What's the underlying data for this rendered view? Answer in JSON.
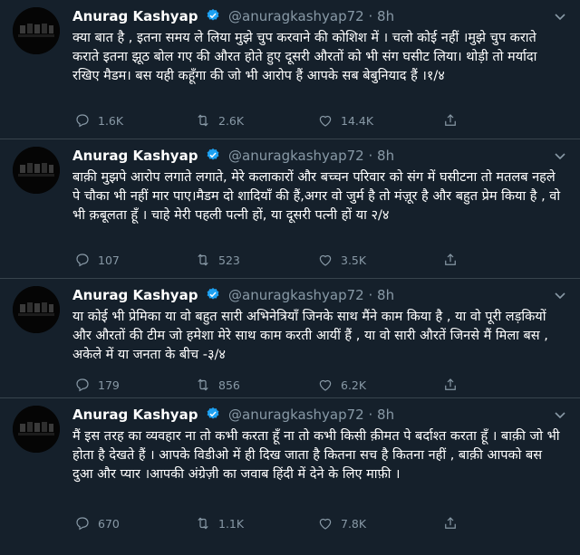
{
  "tweets": [
    {
      "name": "Anurag Kashyap",
      "handle": "@anuragkashyap72",
      "sep": "·",
      "time": "8h",
      "text": "क्या बात है , इतना समय ले लिया मुझे चुप करवाने की कोशिश में । चलो कोई नहीं ।मुझे चुप कराते कराते इतना झूठ बोल गए की औरत होते हुए दूसरी औरतों को भी संग घसीट लिया। थोड़ी तो मर्यादा रखिए मैडम। बस यही कहूँगा की जो भी आरोप हैं आपके सब बेबुनियाद हैं ।१/४",
      "replies": "1.6K",
      "retweets": "2.6K",
      "likes": "14.4K"
    },
    {
      "name": "Anurag Kashyap",
      "handle": "@anuragkashyap72",
      "sep": "·",
      "time": "8h",
      "text": "बाक़ी मुझपे आरोप लगाते लगाते, मेरे कलाकारों और बच्चन परिवार को संग में घसीटना तो मतलब नहले पे चौका भी नहीं मार पाए।मैडम दो शादियाँ की हैं,अगर वो जुर्म है तो मंज़ूर है और बहुत प्रेम किया है , वो भी क़बूलता हूँ । चाहे मेरी पहली पत्नी हों, या दूसरी पत्नी हों या २/४",
      "replies": "107",
      "retweets": "523",
      "likes": "3.5K"
    },
    {
      "name": "Anurag Kashyap",
      "handle": "@anuragkashyap72",
      "sep": "·",
      "time": "8h",
      "text": "या कोई भी प्रेमिका या वो बहुत सारी अभिनेत्रियाँ जिनके साथ मैंने काम किया है , या वो पूरी लड़कियों और औरतों की टीम जो हमेशा मेरे साथ काम करती आयीं हैं , या वो सारी औरतें जिनसे मैं मिला बस , अकेले में या जनता के बीच -३/४",
      "replies": "179",
      "retweets": "856",
      "likes": "6.2K"
    },
    {
      "name": "Anurag Kashyap",
      "handle": "@anuragkashyap72",
      "sep": "·",
      "time": "8h",
      "text": "मैं इस तरह का व्यवहार ना तो कभी करता हूँ ना तो कभी किसी क़ीमत पे बर्दाश्त करता हूँ । बाक़ी जो भी होता है देखते हैं । आपके विडीओ में ही दिख जाता है कितना सच है कितना नहीं , बाक़ी आपको बस दुआ और प्यार ।आपकी अंग्रेज़ी का जवाब हिंदी में देने के लिए माफ़ी ।",
      "replies": "670",
      "retweets": "1.1K",
      "likes": "7.8K"
    }
  ],
  "colors": {
    "background": "#15202b",
    "divider": "#38444d",
    "muted": "#8899a6",
    "verified": "#1da1f2"
  }
}
